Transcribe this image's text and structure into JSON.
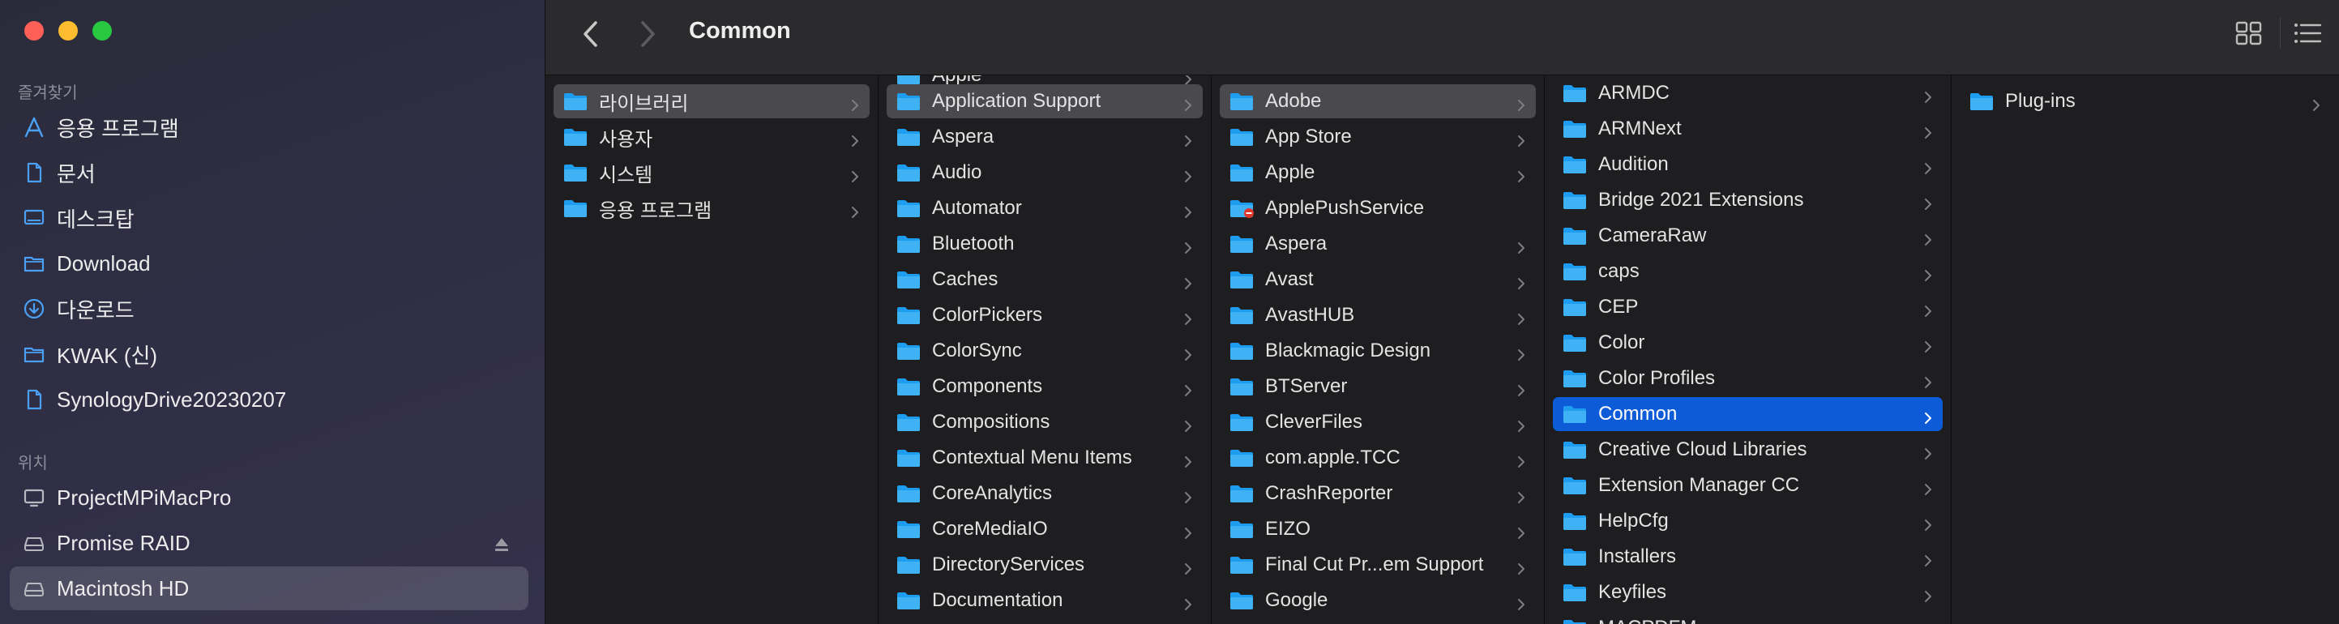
{
  "sidebar": {
    "favorites_title": "즐겨찾기",
    "favorites": [
      {
        "label": "응용 프로그램",
        "icon": "applications-icon"
      },
      {
        "label": "문서",
        "icon": "document-icon"
      },
      {
        "label": "데스크탑",
        "icon": "desktop-icon"
      },
      {
        "label": "Download",
        "icon": "folder-icon"
      },
      {
        "label": "다운로드",
        "icon": "download-icon"
      },
      {
        "label": "KWAK (신)",
        "icon": "folder-icon"
      },
      {
        "label": "SynologyDrive20230207",
        "icon": "document-icon"
      }
    ],
    "locations_title": "위치",
    "locations": [
      {
        "label": "ProjectMPiMacPro",
        "icon": "computer-icon"
      },
      {
        "label": "Promise RAID",
        "icon": "drive-icon",
        "ejectable": true
      },
      {
        "label": "Macintosh HD",
        "icon": "drive-icon",
        "selected": true
      }
    ]
  },
  "toolbar": {
    "title": "Common",
    "back_icon": "chevron-left-icon",
    "forward_icon": "chevron-right-icon",
    "view_grid_icon": "grid-view-icon",
    "view_list_icon": "list-view-icon"
  },
  "columns": {
    "col1": {
      "items": [
        {
          "label": "라이브러리",
          "selected": "gray"
        },
        {
          "label": "사용자"
        },
        {
          "label": "시스템"
        },
        {
          "label": "응용 프로그램"
        }
      ]
    },
    "col2": {
      "partial_top": "Apple",
      "items": [
        {
          "label": "Application Support",
          "selected": "gray"
        },
        {
          "label": "Aspera"
        },
        {
          "label": "Audio"
        },
        {
          "label": "Automator"
        },
        {
          "label": "Bluetooth"
        },
        {
          "label": "Caches"
        },
        {
          "label": "ColorPickers"
        },
        {
          "label": "ColorSync"
        },
        {
          "label": "Components"
        },
        {
          "label": "Compositions"
        },
        {
          "label": "Contextual Menu Items"
        },
        {
          "label": "CoreAnalytics"
        },
        {
          "label": "CoreMediaIO"
        },
        {
          "label": "DirectoryServices"
        },
        {
          "label": "Documentation"
        }
      ]
    },
    "col3": {
      "items": [
        {
          "label": "Adobe",
          "selected": "gray"
        },
        {
          "label": "App Store"
        },
        {
          "label": "Apple"
        },
        {
          "label": "ApplePushService",
          "badge": "restricted",
          "no_chevron": true
        },
        {
          "label": "Aspera"
        },
        {
          "label": "Avast"
        },
        {
          "label": "AvastHUB"
        },
        {
          "label": "Blackmagic Design"
        },
        {
          "label": "BTServer"
        },
        {
          "label": "CleverFiles"
        },
        {
          "label": "com.apple.TCC"
        },
        {
          "label": "CrashReporter"
        },
        {
          "label": "EIZO"
        },
        {
          "label": "Final Cut Pr...em Support"
        },
        {
          "label": "Google"
        }
      ]
    },
    "col4": {
      "items": [
        {
          "label": "ARMDC"
        },
        {
          "label": "ARMNext"
        },
        {
          "label": "Audition"
        },
        {
          "label": "Bridge 2021 Extensions"
        },
        {
          "label": "CameraRaw"
        },
        {
          "label": "caps"
        },
        {
          "label": "CEP"
        },
        {
          "label": "Color"
        },
        {
          "label": "Color Profiles"
        },
        {
          "label": "Common",
          "selected": "blue"
        },
        {
          "label": "Creative Cloud Libraries"
        },
        {
          "label": "Extension Manager CC"
        },
        {
          "label": "HelpCfg"
        },
        {
          "label": "Installers"
        },
        {
          "label": "Keyfiles"
        },
        {
          "label": "MACPDFM"
        }
      ]
    },
    "col5": {
      "items": [
        {
          "label": "Plug-ins"
        }
      ]
    }
  },
  "colors": {
    "selection_blue": "#0e5bd8",
    "folder_blue": "#1e9cf0",
    "sidebar_icon": "#4aa0f5"
  }
}
